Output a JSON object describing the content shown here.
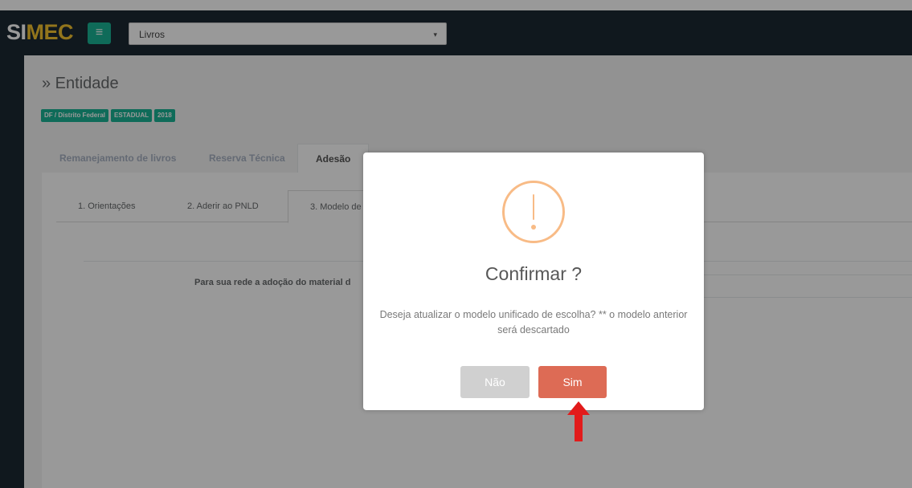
{
  "header": {
    "logo_part1": "SI",
    "logo_part2": "MEC",
    "menu_icon": "hamburger-icon",
    "module_select": {
      "value": "Livros",
      "caret": "▾"
    }
  },
  "page": {
    "title": "» Entidade",
    "badges": [
      "DF / Distrito Federal",
      "ESTADUAL",
      "2018"
    ]
  },
  "main_tabs": [
    {
      "label": "Remanejamento de livros",
      "active": false
    },
    {
      "label": "Reserva Técnica",
      "active": false
    },
    {
      "label": "Adesão",
      "active": true
    }
  ],
  "sub_tabs": [
    {
      "label": "1. Orientações",
      "active": false
    },
    {
      "label": "2. Aderir ao PNLD",
      "active": false
    },
    {
      "label": "3. Modelo de",
      "active": true
    }
  ],
  "content": {
    "question_text": "Para sua rede a adoção do material d"
  },
  "dialog": {
    "icon": "warning-icon",
    "title": "Confirmar ?",
    "message": "Deseja atualizar o modelo unificado de escolha? ** o modelo anterior será descartado",
    "cancel_label": "Não",
    "confirm_label": "Sim",
    "colors": {
      "warning": "#f8bb86",
      "confirm": "#dd6b55",
      "cancel": "#d0d0d0"
    }
  },
  "annotation": {
    "icon": "red-arrow-up-icon",
    "color": "#e21b1b"
  },
  "colors": {
    "navbar": "#1c2832",
    "accent": "#1ab394",
    "logo_accent": "#f4c430"
  }
}
